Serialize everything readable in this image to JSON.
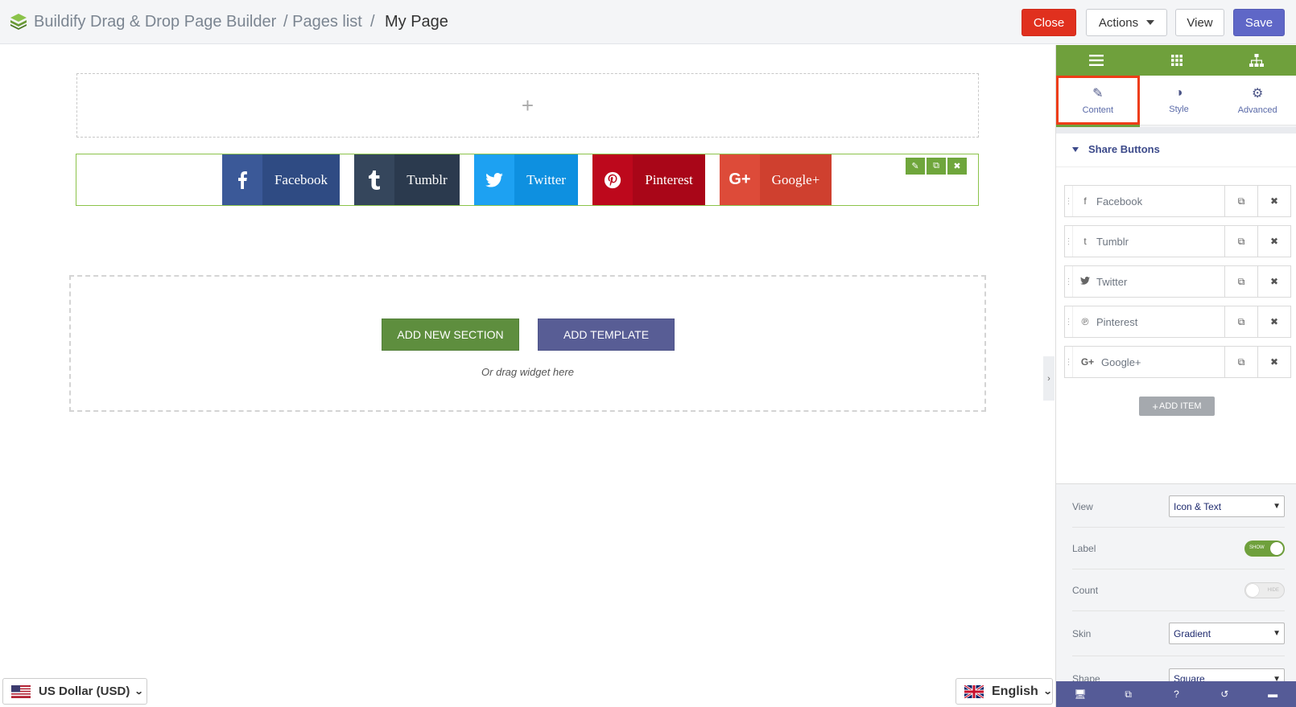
{
  "header": {
    "app_title": "Buildify Drag & Drop Page Builder",
    "crumb_pages": "/ Pages list",
    "crumb_sep": "/",
    "crumb_current": "My Page",
    "close_label": "Close",
    "actions_label": "Actions",
    "view_label": "View",
    "save_label": "Save"
  },
  "canvas": {
    "empty_row_plus": "+",
    "share_buttons": [
      {
        "label": "Facebook",
        "icon": "facebook-icon",
        "color": "#3b5998",
        "color_dark": "#2f4b83"
      },
      {
        "label": "Tumblr",
        "icon": "tumblr-icon",
        "color": "#35465c",
        "color_dark": "#2b3a4e"
      },
      {
        "label": "Twitter",
        "icon": "twitter-icon",
        "color": "#1da1f2",
        "color_dark": "#0e90e0"
      },
      {
        "label": "Pinterest",
        "icon": "pinterest-icon",
        "color": "#bd081c",
        "color_dark": "#a90618"
      },
      {
        "label": "Google+",
        "icon": "google-plus-icon",
        "color": "#dd4b39",
        "color_dark": "#cf402f"
      }
    ],
    "add_section_label": "ADD NEW SECTION",
    "add_template_label": "ADD TEMPLATE",
    "drag_hint": "Or drag widget here"
  },
  "footer": {
    "currency": "US Dollar (USD)",
    "language": "English"
  },
  "panel": {
    "tabs": [
      {
        "label": "Content",
        "icon": "pencil-icon"
      },
      {
        "label": "Style",
        "icon": "contrast-icon"
      },
      {
        "label": "Advanced",
        "icon": "gear-icon"
      }
    ],
    "section_title": "Share Buttons",
    "items": [
      {
        "label": "Facebook",
        "icon": "f"
      },
      {
        "label": "Tumblr",
        "icon": "t"
      },
      {
        "label": "Twitter",
        "icon": "tw"
      },
      {
        "label": "Pinterest",
        "icon": "p"
      },
      {
        "label": "Google+",
        "icon": "G+"
      }
    ],
    "add_item_label": "ADD ITEM",
    "view": {
      "label": "View",
      "value": "Icon & Text"
    },
    "label_toggle": {
      "label": "Label",
      "state": "SHOW",
      "on": true
    },
    "count_toggle": {
      "label": "Count",
      "state": "HIDE",
      "on": false
    },
    "skin": {
      "label": "Skin",
      "value": "Gradient"
    },
    "shape": {
      "label": "Shape",
      "value": "Square"
    }
  },
  "colors": {
    "accent_green": "#6fa03c",
    "accent_purple": "#555b97",
    "close_red": "#e0301e",
    "highlight": "#ee3d18"
  }
}
